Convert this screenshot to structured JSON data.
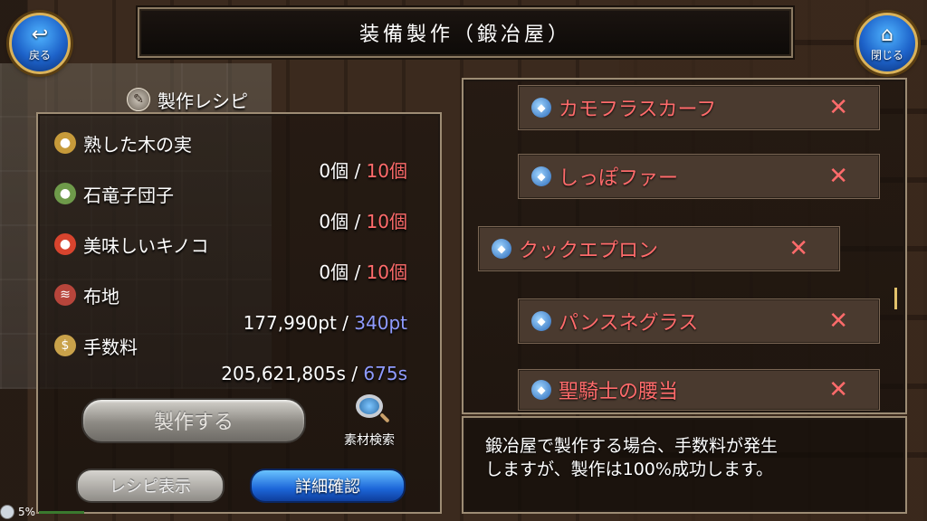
{
  "header": {
    "title": "装備製作（鍛冶屋）"
  },
  "nav": {
    "back_label": "戻る",
    "close_label": "閉じる"
  },
  "recipe": {
    "heading": "製作レシピ",
    "materials": [
      {
        "name": "熟した木の実",
        "have": "0個",
        "need": "10個",
        "icon": "nut-icon",
        "color": "#c69a3a"
      },
      {
        "name": "石竜子団子",
        "have": "0個",
        "need": "10個",
        "icon": "dumpling-icon",
        "color": "#6e9a4a"
      },
      {
        "name": "美味しいキノコ",
        "have": "0個",
        "need": "10個",
        "icon": "mushroom-icon",
        "color": "#d8442e"
      },
      {
        "name": "布地",
        "have": "177,990pt",
        "need": "340pt",
        "icon": "cloth-icon",
        "color": "#b7453b"
      },
      {
        "name": "手数料",
        "have": "205,621,805s",
        "need": "675s",
        "icon": "coin-icon",
        "color": "#c9a24a"
      }
    ],
    "separator": "/",
    "craft_label": "製作する",
    "search_label": "素材検索",
    "tab_recipe": "レシピ表示",
    "tab_detail": "詳細確認"
  },
  "items": [
    {
      "name": "カモフラスカーフ",
      "mark": "✕"
    },
    {
      "name": "しっぽファー",
      "mark": "✕"
    },
    {
      "name": "クックエプロン",
      "mark": "✕"
    },
    {
      "name": "パンスネグラス",
      "mark": "✕"
    },
    {
      "name": "聖騎士の腰当",
      "mark": "✕"
    }
  ],
  "info": {
    "line1": "鍛冶屋で製作する場合、手数料が発生",
    "line2": "しますが、製作は100%成功します。"
  },
  "status": {
    "percent": "5%"
  },
  "colors": {
    "need_red": "#ff6b6b",
    "need_blue": "#8f9bff",
    "accent_gold": "#d9b25a"
  }
}
